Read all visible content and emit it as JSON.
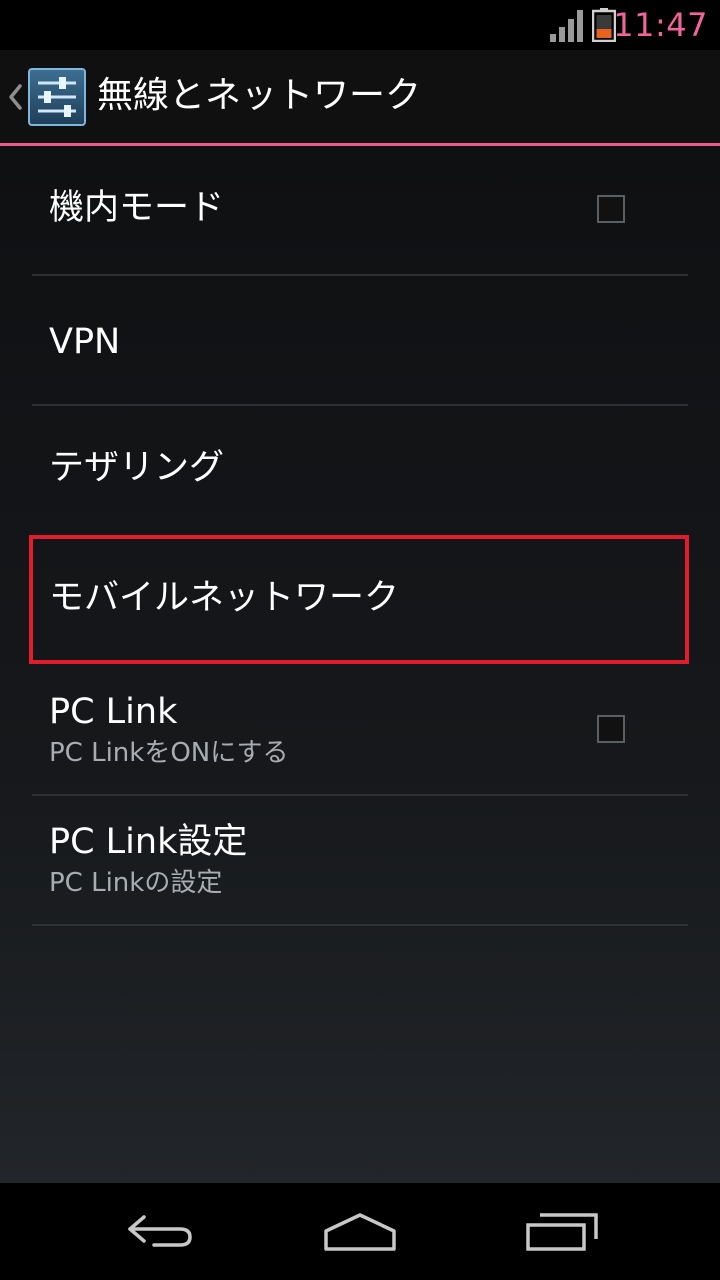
{
  "status_bar": {
    "time": "11:47",
    "time_color": "#f0659b",
    "icons": [
      "signal-icon",
      "battery-icon"
    ],
    "battery_color": "#e8631f"
  },
  "action_bar": {
    "title": "無線とネットワーク",
    "icons": [
      "up-caret-icon",
      "settings-sliders-icon"
    ],
    "accent_color": "#e85b8a"
  },
  "settings": {
    "airplane_mode": {
      "label": "機内モード",
      "checked": false
    },
    "vpn": {
      "label": "VPN"
    },
    "tethering": {
      "label": "テザリング"
    },
    "mobile_network": {
      "label": "モバイルネットワーク",
      "highlight_color": "#e11d2b"
    },
    "pc_link": {
      "label": "PC Link",
      "summary": "PC LinkをONにする",
      "checked": false
    },
    "pc_link_settings": {
      "label": "PC Link設定",
      "summary": "PC Linkの設定"
    }
  },
  "nav_bar": {
    "icons": [
      "back-icon",
      "home-icon",
      "recents-icon"
    ]
  }
}
